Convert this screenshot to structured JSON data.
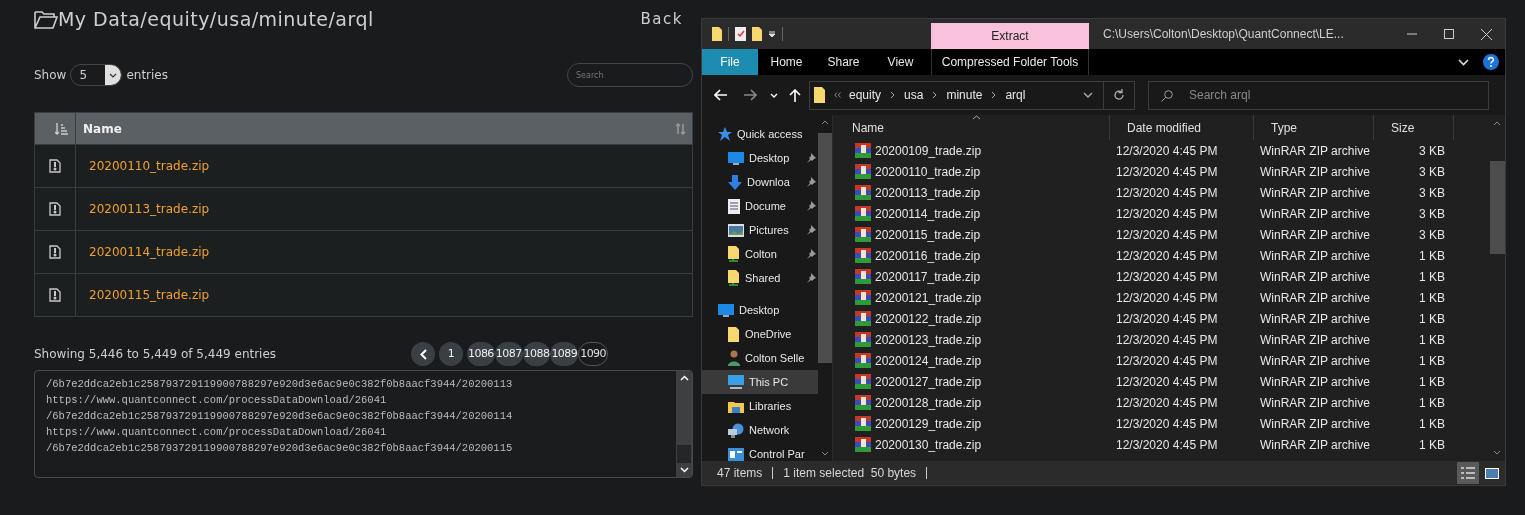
{
  "page": {
    "title": "My Data/equity/usa/minute/arql",
    "back": "Back",
    "show_label": "Show",
    "page_size": "5",
    "entries_label": "entries",
    "search": {
      "placeholder": "Search"
    },
    "table": {
      "columns": [
        "Name"
      ],
      "rows": [
        {
          "name": "20200110_trade.zip"
        },
        {
          "name": "20200113_trade.zip"
        },
        {
          "name": "20200114_trade.zip"
        },
        {
          "name": "20200115_trade.zip"
        }
      ]
    },
    "info": "Showing 5,446 to 5,449 of 5,449 entries",
    "pagination": [
      {
        "kind": "prev",
        "selected": false
      },
      {
        "kind": "page",
        "label": "1",
        "selected": false
      },
      {
        "kind": "page",
        "label": "1086",
        "selected": false
      },
      {
        "kind": "page",
        "label": "1087",
        "selected": false
      },
      {
        "kind": "page",
        "label": "1088",
        "selected": false
      },
      {
        "kind": "page",
        "label": "1089",
        "selected": false
      },
      {
        "kind": "page",
        "label": "1090",
        "selected": true
      }
    ],
    "links": [
      "/6b7e2ddca2eb1c258793729119900788297e920d3e6ac9e0c382f0b8aacf3944/20200113",
      "https://www.quantconnect.com/processDataDownload/26041",
      "/6b7e2ddca2eb1c258793729119900788297e920d3e6ac9e0c382f0b8aacf3944/20200114",
      "https://www.quantconnect.com/processDataDownload/26041",
      "/6b7e2ddca2eb1c258793729119900788297e920d3e6ac9e0c382f0b8aacf3944/20200115"
    ]
  },
  "explorer": {
    "context_tab": "Extract",
    "title": "C:\\Users\\Colton\\Desktop\\QuantConnect\\LE...",
    "ribbon_tabs": [
      {
        "label": "File",
        "kind": "file",
        "selected": false
      },
      {
        "label": "Home",
        "kind": "tab",
        "selected": false
      },
      {
        "label": "Share",
        "kind": "tab",
        "selected": false
      },
      {
        "label": "View",
        "kind": "tab",
        "selected": false
      },
      {
        "label": "Compressed Folder Tools",
        "kind": "context",
        "selected": false
      }
    ],
    "breadcrumbs": [
      "equity",
      "usa",
      "minute",
      "arql"
    ],
    "search": {
      "placeholder": "Search arql"
    },
    "nav": [
      {
        "label": "Quick access",
        "kind": "star",
        "children": [
          {
            "label": "Desktop",
            "kind": "desktop",
            "pinned": true
          },
          {
            "label": "Downloa",
            "kind": "download",
            "pinned": true
          },
          {
            "label": "Docume",
            "kind": "document",
            "pinned": true
          },
          {
            "label": "Pictures",
            "kind": "pictures",
            "pinned": true
          },
          {
            "label": "Colton",
            "kind": "share-folder",
            "pinned": true
          },
          {
            "label": "Shared",
            "kind": "share-folder",
            "pinned": true
          }
        ]
      },
      {
        "label": "Desktop",
        "kind": "desktop",
        "selected": false,
        "children": [
          {
            "label": "OneDrive",
            "kind": "folder",
            "selected": false
          },
          {
            "label": "Colton Selle",
            "kind": "person",
            "selected": false
          },
          {
            "label": "This PC",
            "kind": "pc",
            "selected": true
          },
          {
            "label": "Libraries",
            "kind": "libraries",
            "selected": false
          },
          {
            "label": "Network",
            "kind": "network",
            "selected": false
          },
          {
            "label": "Control Par",
            "kind": "control",
            "selected": false
          }
        ]
      }
    ],
    "columns": [
      "Name",
      "Date modified",
      "Type",
      "Size"
    ],
    "files": [
      {
        "name": "20200109_trade.zip",
        "date": "12/3/2020 4:45 PM",
        "type": "WinRAR ZIP archive",
        "size": "3 KB"
      },
      {
        "name": "20200110_trade.zip",
        "date": "12/3/2020 4:45 PM",
        "type": "WinRAR ZIP archive",
        "size": "3 KB"
      },
      {
        "name": "20200113_trade.zip",
        "date": "12/3/2020 4:45 PM",
        "type": "WinRAR ZIP archive",
        "size": "3 KB"
      },
      {
        "name": "20200114_trade.zip",
        "date": "12/3/2020 4:45 PM",
        "type": "WinRAR ZIP archive",
        "size": "3 KB"
      },
      {
        "name": "20200115_trade.zip",
        "date": "12/3/2020 4:45 PM",
        "type": "WinRAR ZIP archive",
        "size": "3 KB"
      },
      {
        "name": "20200116_trade.zip",
        "date": "12/3/2020 4:45 PM",
        "type": "WinRAR ZIP archive",
        "size": "1 KB"
      },
      {
        "name": "20200117_trade.zip",
        "date": "12/3/2020 4:45 PM",
        "type": "WinRAR ZIP archive",
        "size": "1 KB"
      },
      {
        "name": "20200121_trade.zip",
        "date": "12/3/2020 4:45 PM",
        "type": "WinRAR ZIP archive",
        "size": "1 KB"
      },
      {
        "name": "20200122_trade.zip",
        "date": "12/3/2020 4:45 PM",
        "type": "WinRAR ZIP archive",
        "size": "1 KB"
      },
      {
        "name": "20200123_trade.zip",
        "date": "12/3/2020 4:45 PM",
        "type": "WinRAR ZIP archive",
        "size": "1 KB"
      },
      {
        "name": "20200124_trade.zip",
        "date": "12/3/2020 4:45 PM",
        "type": "WinRAR ZIP archive",
        "size": "1 KB"
      },
      {
        "name": "20200127_trade.zip",
        "date": "12/3/2020 4:45 PM",
        "type": "WinRAR ZIP archive",
        "size": "1 KB"
      },
      {
        "name": "20200128_trade.zip",
        "date": "12/3/2020 4:45 PM",
        "type": "WinRAR ZIP archive",
        "size": "1 KB"
      },
      {
        "name": "20200129_trade.zip",
        "date": "12/3/2020 4:45 PM",
        "type": "WinRAR ZIP archive",
        "size": "1 KB"
      },
      {
        "name": "20200130_trade.zip",
        "date": "12/3/2020 4:45 PM",
        "type": "WinRAR ZIP archive",
        "size": "1 KB"
      }
    ],
    "status": {
      "count": "47 items",
      "selection": "1 item selected  50 bytes"
    }
  }
}
